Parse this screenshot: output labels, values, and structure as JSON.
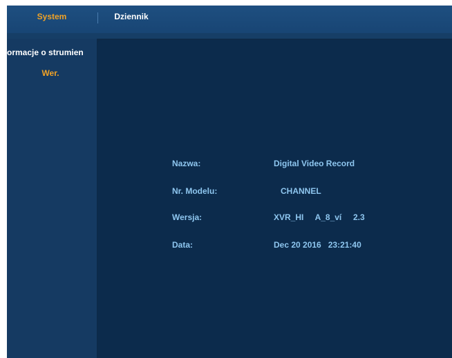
{
  "tabs": [
    {
      "label": "System",
      "active": true
    },
    {
      "label": "Dziennik",
      "active": false
    }
  ],
  "sidebar": {
    "items": [
      {
        "label": "formacje o strumien",
        "active": false
      },
      {
        "label": "Wer.",
        "active": true
      }
    ]
  },
  "info": {
    "rows": [
      {
        "label": "Nazwa:",
        "value": "Digital Video Record"
      },
      {
        "label": "Nr. Modelu:",
        "value": "   CHANNEL"
      },
      {
        "label": "Wersja:",
        "value": "XVR_HI     A_8_ví     2.3"
      },
      {
        "label": "Data:",
        "value": "Dec 20 2016   23:21:40"
      }
    ]
  },
  "colors": {
    "accent": "#f0a226",
    "text": "#ffffff",
    "info_text": "#8ec6ef",
    "background": "#0d2a48"
  }
}
